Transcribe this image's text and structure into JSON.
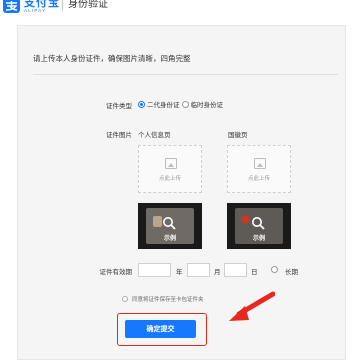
{
  "header": {
    "logo_text": "支付宝",
    "logo_sub": "ALIPAY",
    "title": "身份验证"
  },
  "intro": "请上传本人身份证件，确保图片清晰，四角完整",
  "id_type": {
    "label": "证件类型",
    "options": [
      {
        "label": "二代身份证",
        "checked": true
      },
      {
        "label": "临时身份证",
        "checked": false
      }
    ]
  },
  "id_image": {
    "label": "证件图片",
    "front_label": "个人信息页",
    "back_label": "国徽页",
    "upload_text": "点此上传",
    "sample_label": "示例"
  },
  "validity": {
    "label": "证件有效期",
    "year_unit": "年",
    "month_unit": "月",
    "day_unit": "日",
    "longterm_label": "长期"
  },
  "agree_text": "同意将证件保存至卡包证件夹",
  "submit_label": "确定提交",
  "colors": {
    "brand": "#1677ff",
    "highlight": "#e8281e"
  }
}
